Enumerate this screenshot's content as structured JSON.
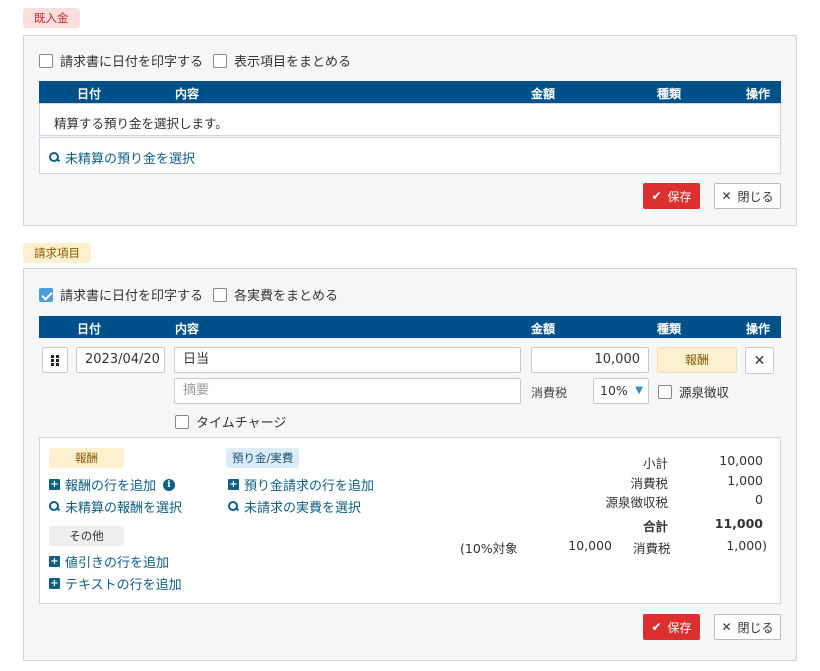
{
  "section1": {
    "tag": "既入金",
    "options": [
      {
        "label": "請求書に日付を印字する",
        "checked": false
      },
      {
        "label": "表示項目をまとめる",
        "checked": false
      }
    ],
    "columns": {
      "date": "日付",
      "content": "内容",
      "amount": "金額",
      "type": "種類",
      "action": "操作"
    },
    "empty_message": "精算する預り金を選択します。",
    "select_link": "未精算の預り金を選択",
    "save_label": "保存",
    "close_label": "閉じる"
  },
  "section2": {
    "tag": "請求項目",
    "options": [
      {
        "label": "請求書に日付を印字する",
        "checked": true
      },
      {
        "label": "各実費をまとめる",
        "checked": false
      }
    ],
    "columns": {
      "date": "日付",
      "content": "内容",
      "amount": "金額",
      "type": "種類",
      "action": "操作"
    },
    "row": {
      "date": "2023/04/20",
      "content": "日当",
      "summary_placeholder": "摘要",
      "amount": "10,000",
      "type_badge": "報酬",
      "tax_label": "消費税",
      "tax_rate": "10%",
      "withholding_label": "源泉徴収",
      "timecharge_label": "タイムチャージ"
    },
    "groups": {
      "fee": {
        "tag": "報酬",
        "add_row": "報酬の行を追加",
        "select_unsettled": "未精算の報酬を選択"
      },
      "deposit": {
        "tag": "預り金/実費",
        "add_row": "預り金請求の行を追加",
        "select_unbilled": "未請求の実費を選択"
      },
      "other": {
        "tag": "その他",
        "add_discount": "値引きの行を追加",
        "add_text": "テキストの行を追加"
      }
    },
    "summary": {
      "subtotal_label": "小計",
      "subtotal": "10,000",
      "tax_label": "消費税",
      "tax": "1,000",
      "withholding_label": "源泉徴収税",
      "withholding": "0",
      "total_label": "合計",
      "total": "11,000",
      "breakdown_open": "(10%対象",
      "breakdown_base": "10,000",
      "breakdown_tax_label": "消費税",
      "breakdown_tax": "1,000)"
    },
    "save_label": "保存",
    "close_label": "閉じる"
  },
  "colors": {
    "header": "#00508a",
    "save": "#dc3030",
    "link": "#0e5f84",
    "checked": "#4a9fd8"
  }
}
